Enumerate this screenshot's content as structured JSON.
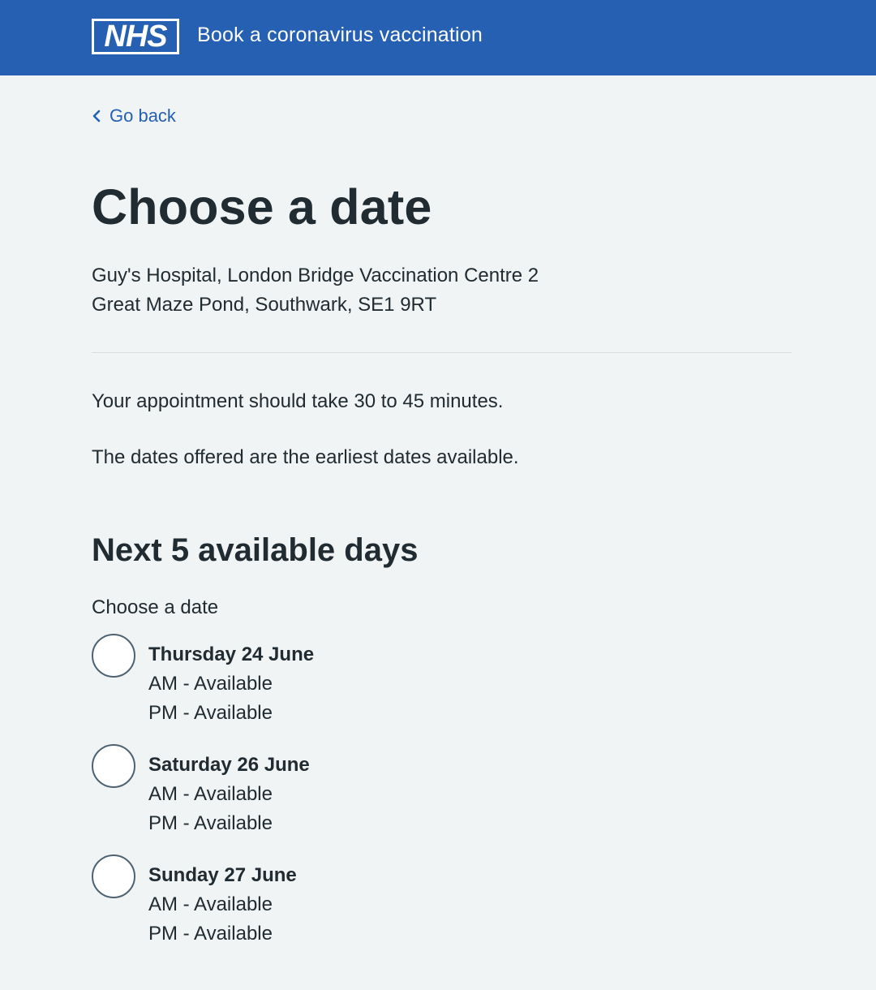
{
  "header": {
    "logo_text": "NHS",
    "service_name": "Book a coronavirus vaccination",
    "color": "#2560b3"
  },
  "back_link": {
    "label": "Go back",
    "icon": "chevron-left-icon"
  },
  "page_title": "Choose a date",
  "location": {
    "line1": "Guy's Hospital, London Bridge Vaccination Centre 2",
    "line2": "Great Maze Pond, Southwark, SE1 9RT"
  },
  "info": {
    "duration": "Your appointment should take 30 to 45 minutes.",
    "earliest": "The dates offered are the earliest dates available."
  },
  "section_heading": "Next 5 available days",
  "date_picker": {
    "legend": "Choose a date",
    "options": [
      {
        "date": "Thursday 24 June",
        "am": "AM - Available",
        "pm": "PM - Available"
      },
      {
        "date": "Saturday 26 June",
        "am": "AM - Available",
        "pm": "PM - Available"
      },
      {
        "date": "Sunday 27 June",
        "am": "AM - Available",
        "pm": "PM - Available"
      }
    ]
  }
}
